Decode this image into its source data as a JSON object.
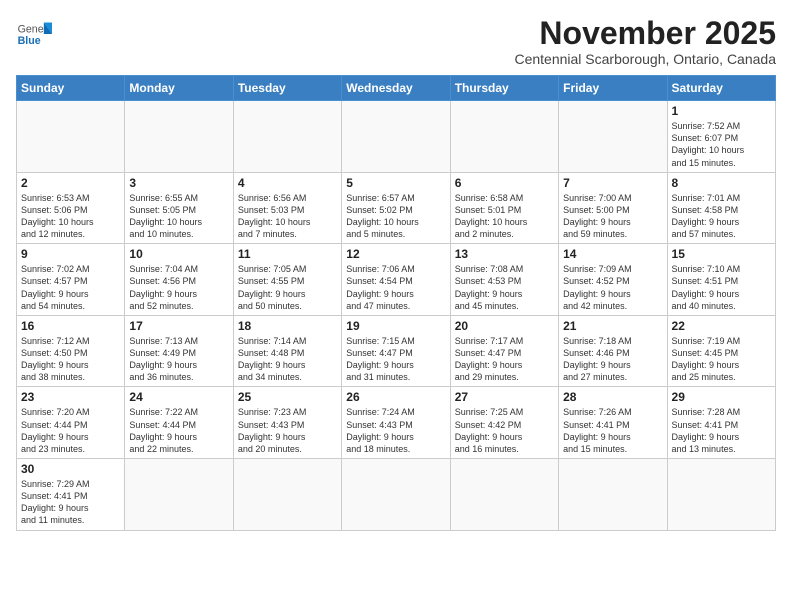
{
  "header": {
    "logo_general": "General",
    "logo_blue": "Blue",
    "month_year": "November 2025",
    "subtitle": "Centennial Scarborough, Ontario, Canada"
  },
  "days_of_week": [
    "Sunday",
    "Monday",
    "Tuesday",
    "Wednesday",
    "Thursday",
    "Friday",
    "Saturday"
  ],
  "weeks": [
    [
      {
        "day": "",
        "content": ""
      },
      {
        "day": "",
        "content": ""
      },
      {
        "day": "",
        "content": ""
      },
      {
        "day": "",
        "content": ""
      },
      {
        "day": "",
        "content": ""
      },
      {
        "day": "",
        "content": ""
      },
      {
        "day": "1",
        "content": "Sunrise: 7:52 AM\nSunset: 6:07 PM\nDaylight: 10 hours\nand 15 minutes."
      }
    ],
    [
      {
        "day": "2",
        "content": "Sunrise: 6:53 AM\nSunset: 5:06 PM\nDaylight: 10 hours\nand 12 minutes."
      },
      {
        "day": "3",
        "content": "Sunrise: 6:55 AM\nSunset: 5:05 PM\nDaylight: 10 hours\nand 10 minutes."
      },
      {
        "day": "4",
        "content": "Sunrise: 6:56 AM\nSunset: 5:03 PM\nDaylight: 10 hours\nand 7 minutes."
      },
      {
        "day": "5",
        "content": "Sunrise: 6:57 AM\nSunset: 5:02 PM\nDaylight: 10 hours\nand 5 minutes."
      },
      {
        "day": "6",
        "content": "Sunrise: 6:58 AM\nSunset: 5:01 PM\nDaylight: 10 hours\nand 2 minutes."
      },
      {
        "day": "7",
        "content": "Sunrise: 7:00 AM\nSunset: 5:00 PM\nDaylight: 9 hours\nand 59 minutes."
      },
      {
        "day": "8",
        "content": "Sunrise: 7:01 AM\nSunset: 4:58 PM\nDaylight: 9 hours\nand 57 minutes."
      }
    ],
    [
      {
        "day": "9",
        "content": "Sunrise: 7:02 AM\nSunset: 4:57 PM\nDaylight: 9 hours\nand 54 minutes."
      },
      {
        "day": "10",
        "content": "Sunrise: 7:04 AM\nSunset: 4:56 PM\nDaylight: 9 hours\nand 52 minutes."
      },
      {
        "day": "11",
        "content": "Sunrise: 7:05 AM\nSunset: 4:55 PM\nDaylight: 9 hours\nand 50 minutes."
      },
      {
        "day": "12",
        "content": "Sunrise: 7:06 AM\nSunset: 4:54 PM\nDaylight: 9 hours\nand 47 minutes."
      },
      {
        "day": "13",
        "content": "Sunrise: 7:08 AM\nSunset: 4:53 PM\nDaylight: 9 hours\nand 45 minutes."
      },
      {
        "day": "14",
        "content": "Sunrise: 7:09 AM\nSunset: 4:52 PM\nDaylight: 9 hours\nand 42 minutes."
      },
      {
        "day": "15",
        "content": "Sunrise: 7:10 AM\nSunset: 4:51 PM\nDaylight: 9 hours\nand 40 minutes."
      }
    ],
    [
      {
        "day": "16",
        "content": "Sunrise: 7:12 AM\nSunset: 4:50 PM\nDaylight: 9 hours\nand 38 minutes."
      },
      {
        "day": "17",
        "content": "Sunrise: 7:13 AM\nSunset: 4:49 PM\nDaylight: 9 hours\nand 36 minutes."
      },
      {
        "day": "18",
        "content": "Sunrise: 7:14 AM\nSunset: 4:48 PM\nDaylight: 9 hours\nand 34 minutes."
      },
      {
        "day": "19",
        "content": "Sunrise: 7:15 AM\nSunset: 4:47 PM\nDaylight: 9 hours\nand 31 minutes."
      },
      {
        "day": "20",
        "content": "Sunrise: 7:17 AM\nSunset: 4:47 PM\nDaylight: 9 hours\nand 29 minutes."
      },
      {
        "day": "21",
        "content": "Sunrise: 7:18 AM\nSunset: 4:46 PM\nDaylight: 9 hours\nand 27 minutes."
      },
      {
        "day": "22",
        "content": "Sunrise: 7:19 AM\nSunset: 4:45 PM\nDaylight: 9 hours\nand 25 minutes."
      }
    ],
    [
      {
        "day": "23",
        "content": "Sunrise: 7:20 AM\nSunset: 4:44 PM\nDaylight: 9 hours\nand 23 minutes."
      },
      {
        "day": "24",
        "content": "Sunrise: 7:22 AM\nSunset: 4:44 PM\nDaylight: 9 hours\nand 22 minutes."
      },
      {
        "day": "25",
        "content": "Sunrise: 7:23 AM\nSunset: 4:43 PM\nDaylight: 9 hours\nand 20 minutes."
      },
      {
        "day": "26",
        "content": "Sunrise: 7:24 AM\nSunset: 4:43 PM\nDaylight: 9 hours\nand 18 minutes."
      },
      {
        "day": "27",
        "content": "Sunrise: 7:25 AM\nSunset: 4:42 PM\nDaylight: 9 hours\nand 16 minutes."
      },
      {
        "day": "28",
        "content": "Sunrise: 7:26 AM\nSunset: 4:41 PM\nDaylight: 9 hours\nand 15 minutes."
      },
      {
        "day": "29",
        "content": "Sunrise: 7:28 AM\nSunset: 4:41 PM\nDaylight: 9 hours\nand 13 minutes."
      }
    ],
    [
      {
        "day": "30",
        "content": "Sunrise: 7:29 AM\nSunset: 4:41 PM\nDaylight: 9 hours\nand 11 minutes."
      },
      {
        "day": "",
        "content": ""
      },
      {
        "day": "",
        "content": ""
      },
      {
        "day": "",
        "content": ""
      },
      {
        "day": "",
        "content": ""
      },
      {
        "day": "",
        "content": ""
      },
      {
        "day": "",
        "content": ""
      }
    ]
  ]
}
